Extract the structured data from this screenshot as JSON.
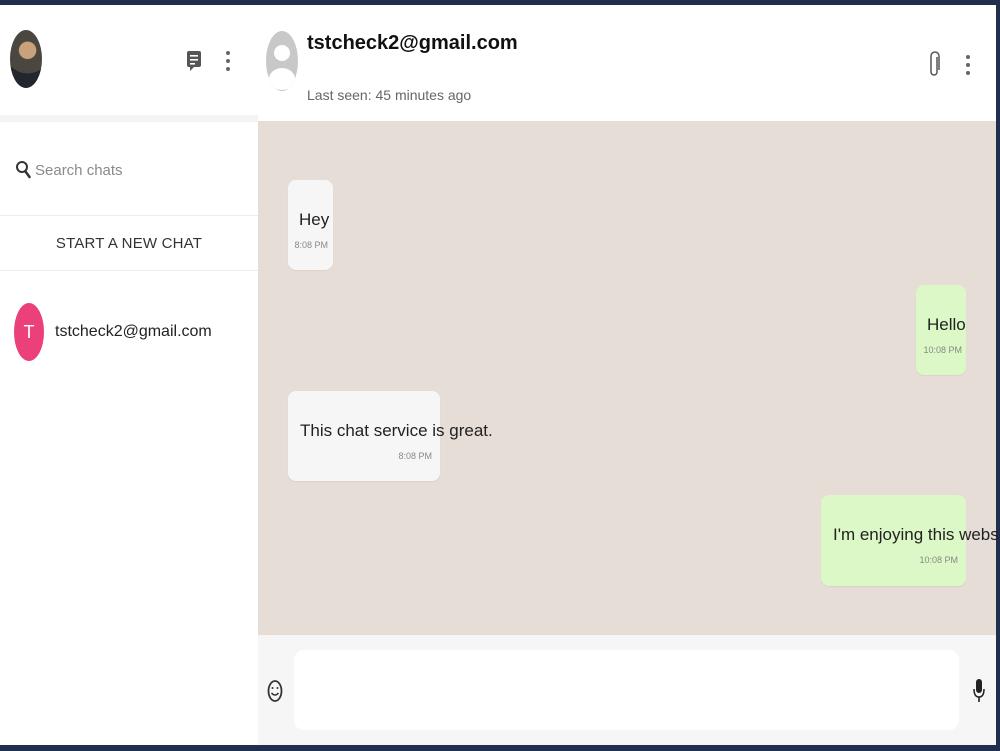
{
  "sidebar": {
    "search_placeholder": "Search chats",
    "new_chat_label": "START A NEW CHAT",
    "chats": [
      {
        "avatar_letter": "T",
        "name": "tstcheck2@gmail.com"
      }
    ]
  },
  "header": {
    "contact_name": "tstcheck2@gmail.com",
    "last_seen": "Last seen: 45 minutes ago"
  },
  "messages": [
    {
      "direction": "in",
      "text": "Hey",
      "time": "8:08 PM"
    },
    {
      "direction": "out",
      "text": "Hello",
      "time": "10:08 PM"
    },
    {
      "direction": "in",
      "text": "This chat service is great.",
      "time": "8:08 PM"
    },
    {
      "direction": "out",
      "text": "I'm enjoying this website",
      "time": "10:08 PM"
    }
  ],
  "composer": {
    "input_value": "",
    "input_placeholder": ""
  },
  "icons": {
    "chat": "message-icon",
    "menu": "vertical-dots-icon",
    "search": "search-icon",
    "attach": "paperclip-icon",
    "emoji": "emoji-icon",
    "mic": "microphone-icon"
  },
  "colors": {
    "frame": "#1f2f4d",
    "chat_background": "#e6ddd6",
    "incoming_bubble": "#f6f6f6",
    "outgoing_bubble": "#dcf8c6",
    "contact_avatar_accent": "#ec407a"
  }
}
